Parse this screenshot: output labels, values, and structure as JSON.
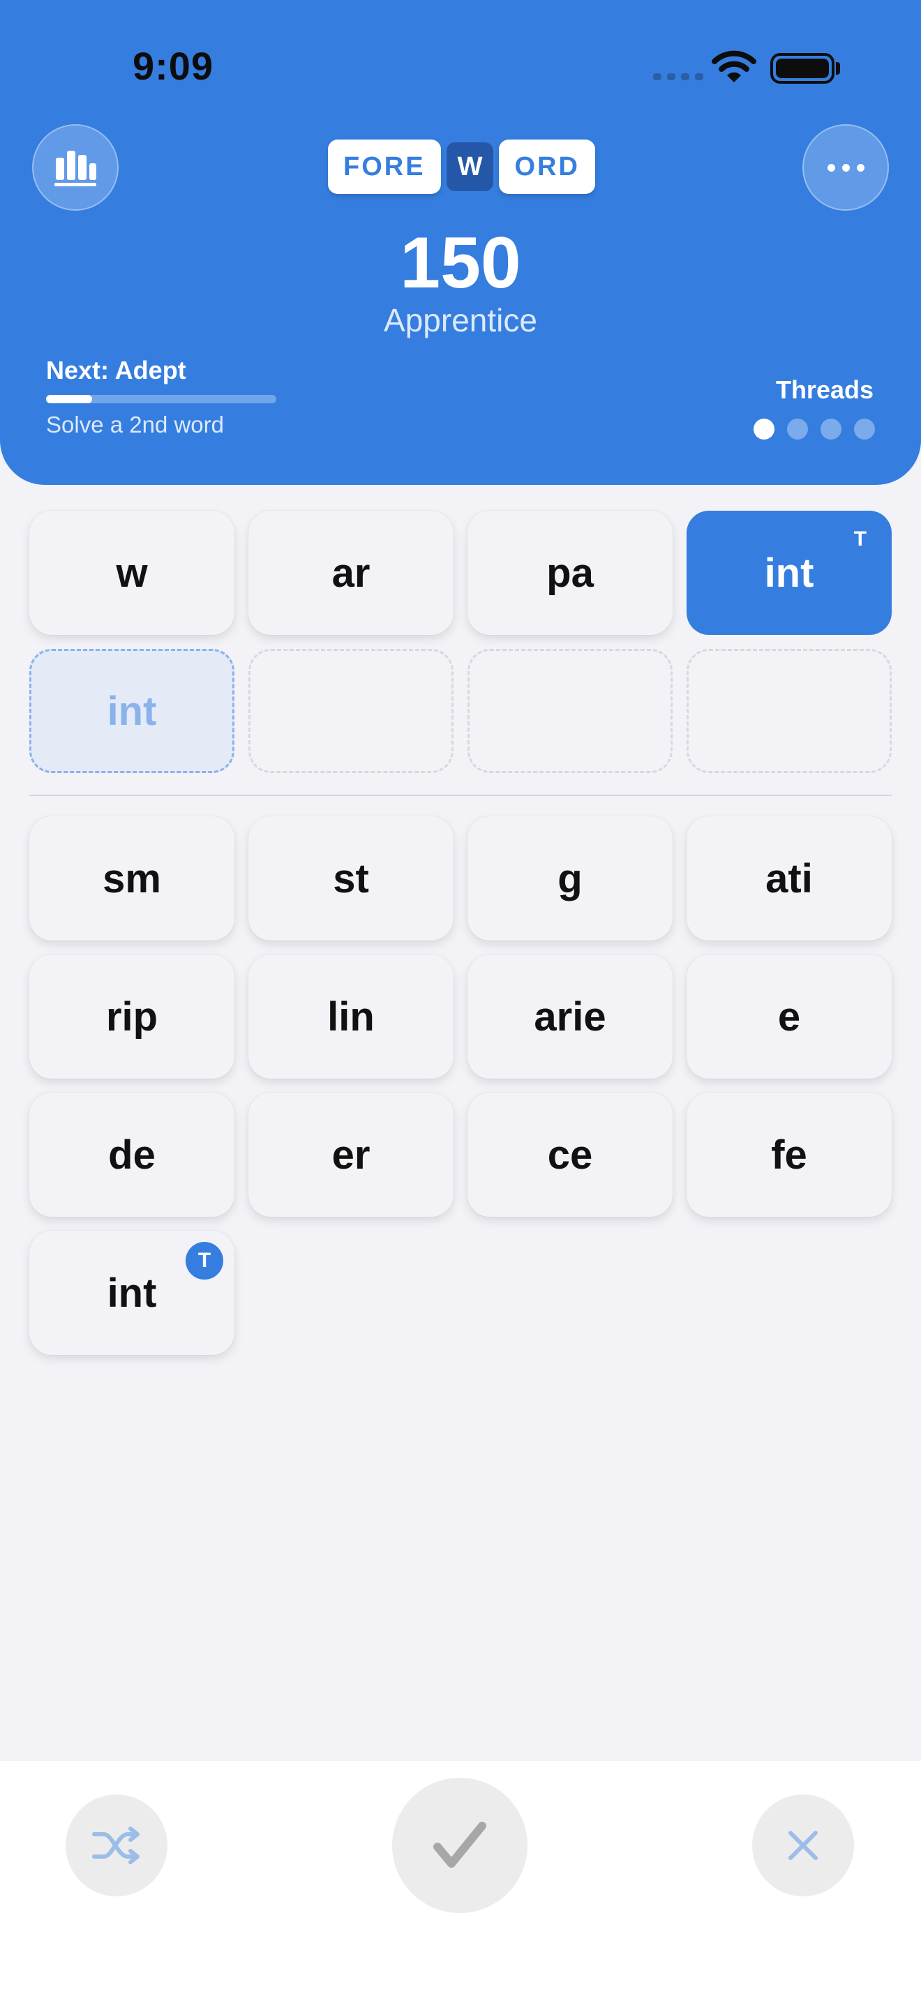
{
  "status_bar": {
    "time": "9:09"
  },
  "header": {
    "logo": {
      "left": "FORE",
      "middle": "W",
      "right": "ORD"
    },
    "score": "150",
    "rank": "Apprentice",
    "next_label": "Next: Adept",
    "next_progress": 0.2,
    "next_hint": "Solve a 2nd word",
    "threads_label": "Threads",
    "threads_total": 4,
    "threads_active_index": 0
  },
  "selected_tiles": [
    "w",
    "ar",
    "pa",
    "int"
  ],
  "selected_tile_marker": "T",
  "answer_slots": [
    "int",
    "",
    "",
    ""
  ],
  "pool_rows": [
    [
      "sm",
      "st",
      "g",
      "ati"
    ],
    [
      "rip",
      "lin",
      "arie",
      "e"
    ],
    [
      "de",
      "er",
      "ce",
      "fe"
    ],
    [
      "int"
    ]
  ],
  "pool_badge": "T",
  "colors": {
    "accent": "#357ee0",
    "background": "#f2f2f7",
    "logo_middle": "#2557a8",
    "slot_fill": "#e4ebf7"
  },
  "icons": {
    "stats": "bar-chart-icon",
    "more": "ellipsis-icon",
    "shuffle": "shuffle-icon",
    "submit": "checkmark-icon",
    "clear": "close-icon"
  }
}
